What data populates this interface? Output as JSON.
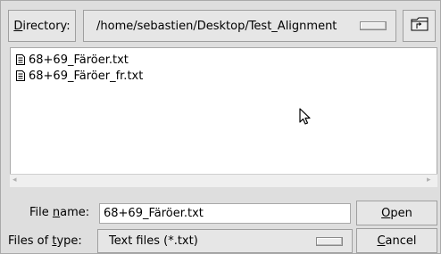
{
  "directory": {
    "label_prefix": "D",
    "label_rest": "irectory:",
    "path": "/home/sebastien/Desktop/Test_Alignment"
  },
  "file_list": {
    "items": [
      {
        "name": "68+69_Färöer.txt",
        "icon": "text-file-icon"
      },
      {
        "name": "68+69_Färöer_fr.txt",
        "icon": "text-file-icon"
      }
    ]
  },
  "file_name": {
    "label_pre": "File ",
    "label_ul": "n",
    "label_post": "ame:",
    "value": "68+69_Färöer.txt"
  },
  "file_type": {
    "label_pre": "Files of ",
    "label_ul": "t",
    "label_post": "ype:",
    "value": "Text files (*.txt)"
  },
  "buttons": {
    "open_ul": "O",
    "open_rest": "pen",
    "cancel_ul": "C",
    "cancel_rest": "ancel"
  }
}
